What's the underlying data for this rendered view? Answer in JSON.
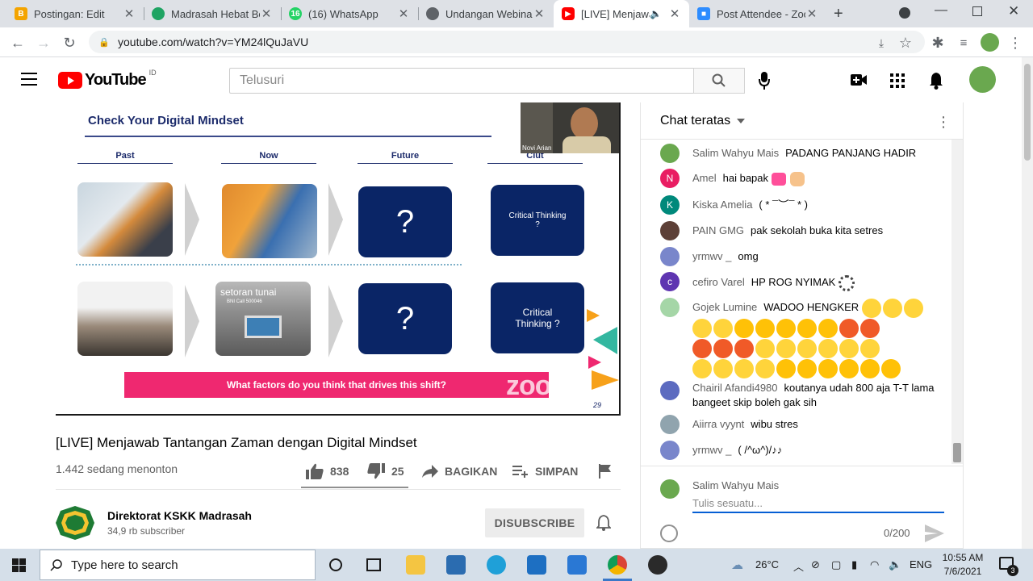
{
  "browser": {
    "tabs": [
      {
        "title": "Postingan: Edit",
        "color": "#f4a400",
        "active": false
      },
      {
        "title": "Madrasah Hebat Be",
        "color": "#1fa463",
        "active": false
      },
      {
        "title": "(16) WhatsApp",
        "color": "#25d366",
        "active": false
      },
      {
        "title": "Undangan Webinar",
        "color": "#5f6368",
        "active": false
      },
      {
        "title": "[LIVE] Menjawab",
        "color": "#ff0000",
        "active": true
      },
      {
        "title": "Post Attendee - Zoo",
        "color": "#2d8cff",
        "active": false
      }
    ],
    "url": "youtube.com/watch?v=YM24lQuJaVU"
  },
  "youtube": {
    "logo_text": "YouTube",
    "region": "ID",
    "search_placeholder": "Telusuri"
  },
  "slide": {
    "title": "Check Your Digital Mindset",
    "columns": [
      "Past",
      "Now",
      "Future",
      "Ciut"
    ],
    "question_mark": "?",
    "critical_thinking": "Critical Thinking ?",
    "banner": "What factors do you think that drives this shift?",
    "watermark": "zoom",
    "page_number": "29",
    "presenter_name": "Novi Arian",
    "atm_sign": "setoran tunai",
    "atm_subsign": "BNI Call 500046"
  },
  "video": {
    "title": "[LIVE] Menjawab Tantangan Zaman dengan Digital Mindset",
    "viewers": "1.442 sedang menonton",
    "likes": "838",
    "dislikes": "25",
    "share_label": "BAGIKAN",
    "save_label": "SIMPAN"
  },
  "channel": {
    "name": "Direktorat KSKK Madrasah",
    "subscribers": "34,9 rb subscriber",
    "subscribe_button": "DISUBSCRIBE"
  },
  "chat": {
    "header": "Chat teratas",
    "messages": [
      {
        "author": "Salim Wahyu Mais",
        "text": "PADANG PANJANG HADIR",
        "initial": "",
        "avatar_color": "#6aa84f"
      },
      {
        "author": "Amel",
        "text": "hai bapak",
        "initial": "N",
        "avatar_color": "#e91e63"
      },
      {
        "author": "Kiska Amelia",
        "text": "( * ¯︶¯ * )",
        "initial": "K",
        "avatar_color": "#00897b"
      },
      {
        "author": "PAIN GMG",
        "text": "pak sekolah buka kita setres",
        "initial": "",
        "avatar_color": "#5d4037"
      },
      {
        "author": "yrmwv _",
        "text": "omg",
        "initial": "",
        "avatar_color": "#7986cb"
      },
      {
        "author": "cefiro Varel",
        "text": "HP ROG NYIMAK",
        "initial": "c",
        "avatar_color": "#5e35b1"
      },
      {
        "author": "Gojek Lumine",
        "text": "WADOO HENGKER",
        "initial": "",
        "avatar_color": "#a5d6a7"
      },
      {
        "author": "Chairil Afandi4980",
        "text": "koutanya udah 800 aja T-T lama bangeet skip boleh gak sih",
        "initial": "",
        "avatar_color": "#5c6bc0"
      },
      {
        "author": "Aiirra vyynt",
        "text": "wibu stres",
        "initial": "",
        "avatar_color": "#90a4ae"
      },
      {
        "author": "yrmwv _",
        "text": "( /^ω^)/♪♪",
        "initial": "",
        "avatar_color": "#7986cb"
      }
    ],
    "my_name": "Salim Wahyu Mais",
    "input_placeholder": "Tulis sesuatu...",
    "char_count": "0/200"
  },
  "taskbar": {
    "search_placeholder": "Type here to search",
    "temperature": "26°C",
    "language": "ENG",
    "time": "10:55 AM",
    "date": "7/6/2021",
    "notifications": "3"
  }
}
